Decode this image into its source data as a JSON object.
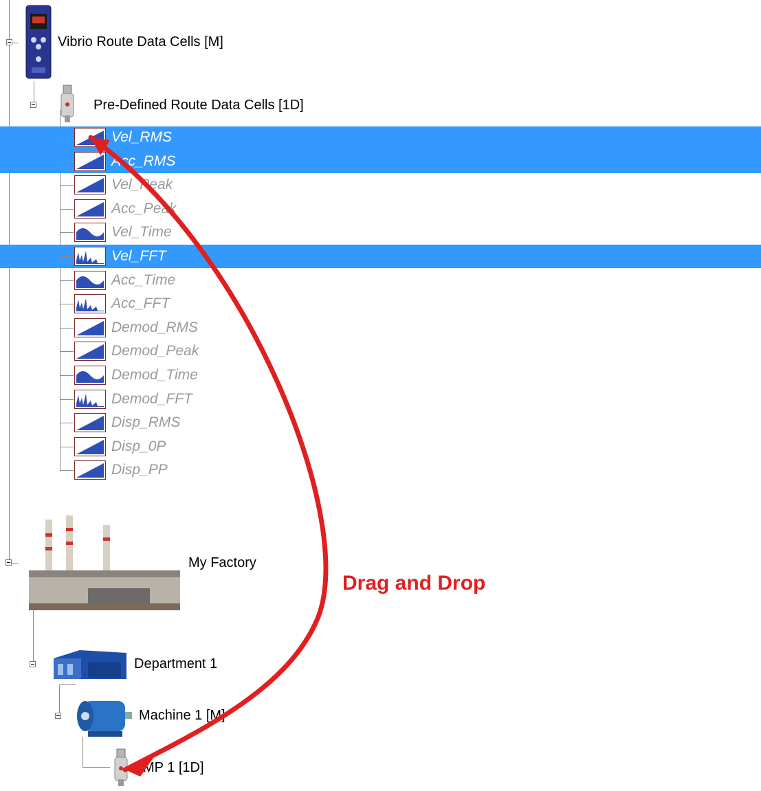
{
  "tree": {
    "root_device": {
      "label": "Vibrio Route Data Cells [M]",
      "icon": "vibrio-device-icon"
    },
    "predefined": {
      "label": "Pre-Defined Route Data Cells [1D]",
      "icon": "sensor-icon"
    },
    "cells": [
      {
        "label": "Vel_RMS",
        "icon": "trend-chart-icon",
        "selected": true
      },
      {
        "label": "Acc_RMS",
        "icon": "trend-chart-icon",
        "selected": true
      },
      {
        "label": "Vel_Peak",
        "icon": "trend-chart-icon",
        "selected": false
      },
      {
        "label": "Acc_Peak",
        "icon": "trend-chart-icon",
        "selected": false
      },
      {
        "label": "Vel_Time",
        "icon": "waveform-icon",
        "selected": false
      },
      {
        "label": "Vel_FFT",
        "icon": "spectrum-icon",
        "selected": true
      },
      {
        "label": "Acc_Time",
        "icon": "waveform-icon",
        "selected": false
      },
      {
        "label": "Acc_FFT",
        "icon": "spectrum-icon",
        "selected": false
      },
      {
        "label": "Demod_RMS",
        "icon": "trend-chart-icon",
        "selected": false
      },
      {
        "label": "Demod_Peak",
        "icon": "trend-chart-icon",
        "selected": false
      },
      {
        "label": "Demod_Time",
        "icon": "waveform-icon",
        "selected": false
      },
      {
        "label": "Demod_FFT",
        "icon": "spectrum-icon",
        "selected": false
      },
      {
        "label": "Disp_RMS",
        "icon": "trend-chart-icon",
        "selected": false
      },
      {
        "label": "Disp_0P",
        "icon": "trend-chart-icon",
        "selected": false
      },
      {
        "label": "Disp_PP",
        "icon": "trend-chart-icon",
        "selected": false
      }
    ],
    "factory": {
      "label": "My Factory",
      "icon": "factory-icon"
    },
    "department": {
      "label": "Department 1",
      "icon": "building-icon"
    },
    "machine": {
      "label": "Machine 1 [M]",
      "icon": "motor-icon"
    },
    "measurement_point": {
      "label": "MP 1 [1D]",
      "icon": "sensor-icon"
    }
  },
  "annotation": {
    "text": "Drag and Drop",
    "color": "#e02020"
  },
  "colors": {
    "selection": "#3399ff",
    "chart_fill": "#2f4fb8",
    "chart_border": "#7a2a2a"
  }
}
